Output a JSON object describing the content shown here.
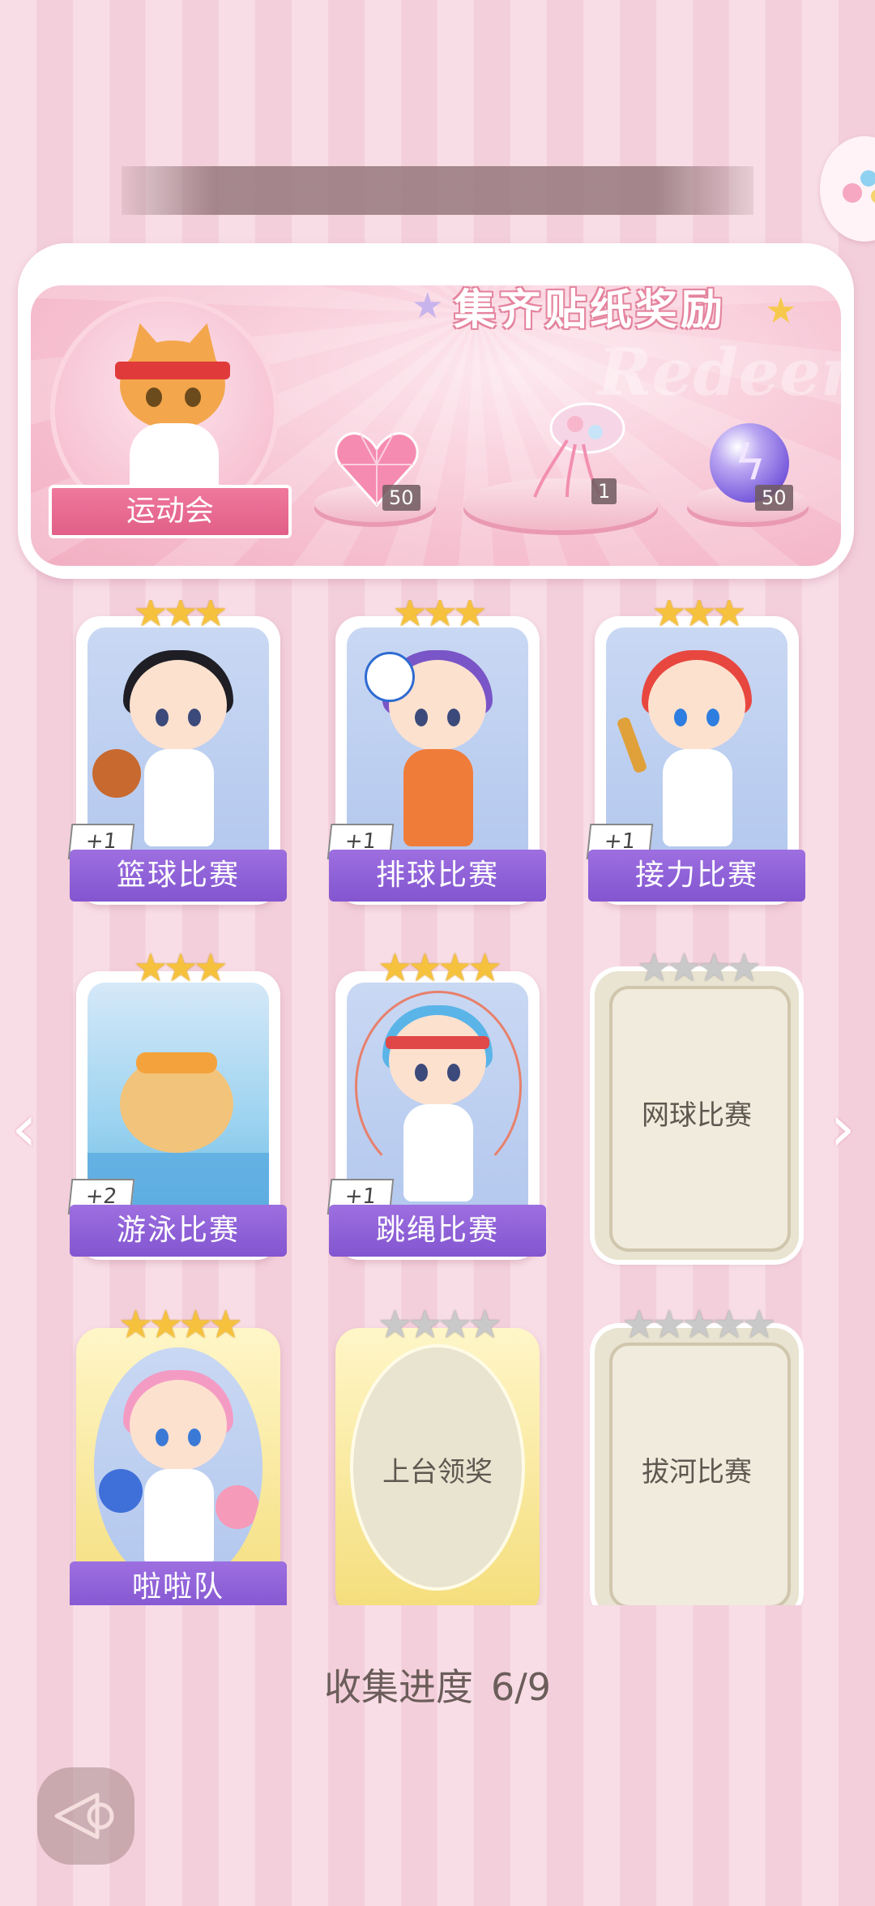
{
  "banner": {
    "title": "集齐贴纸奖励",
    "watermark": "Redeem",
    "theme_label": "运动会",
    "rewards": [
      {
        "icon": "pink-heart-gem-icon",
        "quantity": "50"
      },
      {
        "icon": "ribbon-bouquet-icon",
        "quantity": "1"
      },
      {
        "icon": "purple-lightning-orb-icon",
        "quantity": "50"
      }
    ]
  },
  "cards": [
    {
      "label": "篮球比赛",
      "badge": "+1",
      "stars": 3,
      "state": "collected"
    },
    {
      "label": "排球比赛",
      "badge": "+1",
      "stars": 3,
      "state": "collected"
    },
    {
      "label": "接力比赛",
      "badge": "+1",
      "stars": 3,
      "state": "collected"
    },
    {
      "label": "游泳比赛",
      "badge": "+2",
      "stars": 3,
      "state": "collected"
    },
    {
      "label": "跳绳比赛",
      "badge": "+1",
      "stars": 4,
      "state": "collected"
    },
    {
      "label": "网球比赛",
      "stars": 4,
      "state": "locked"
    },
    {
      "label": "啦啦队",
      "stars": 4,
      "state": "collected"
    },
    {
      "label": "上台领奖",
      "stars": 4,
      "state": "locked"
    },
    {
      "label": "拔河比赛",
      "stars": 5,
      "state": "locked"
    }
  ],
  "progress": {
    "label": "收集进度",
    "value": "6/9"
  },
  "colors": {
    "accent_pink": "#e05d86",
    "label_purple": "#8355d0",
    "star_gold": "#f6c23e"
  }
}
